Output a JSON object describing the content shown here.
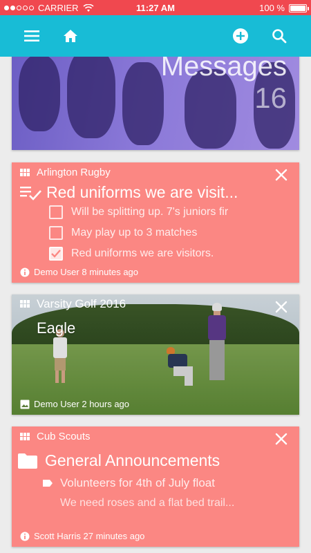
{
  "status_bar": {
    "carrier": "CARRIER",
    "time": "11:27 AM",
    "battery": "100 %",
    "battery_level": 1.0
  },
  "app_bar": {
    "icons": [
      "menu-icon",
      "home-icon",
      "add-circle-icon",
      "search-icon"
    ]
  },
  "messages_card": {
    "title": "Messages",
    "count": "16"
  },
  "cards": [
    {
      "group": "Arlington Rugby",
      "headline": "Red uniforms we are visit...",
      "items": [
        {
          "text": "Will be splitting up. 7's juniors fir",
          "checked": false
        },
        {
          "text": "May play up to 3 matches",
          "checked": false
        },
        {
          "text": "Red uniforms we are visitors.",
          "checked": true
        }
      ],
      "footer": "Demo User 8 minutes ago"
    },
    {
      "group": "Varsity Golf 2016",
      "title": "Eagle",
      "footer": "Demo User 2 hours ago"
    },
    {
      "group": "Cub Scouts",
      "headline": "General Announcements",
      "subheadline": "Volunteers for 4th of July float",
      "body": "We need roses and a flat bed trail...",
      "footer": "Scott Harris 27 minutes ago"
    }
  ]
}
